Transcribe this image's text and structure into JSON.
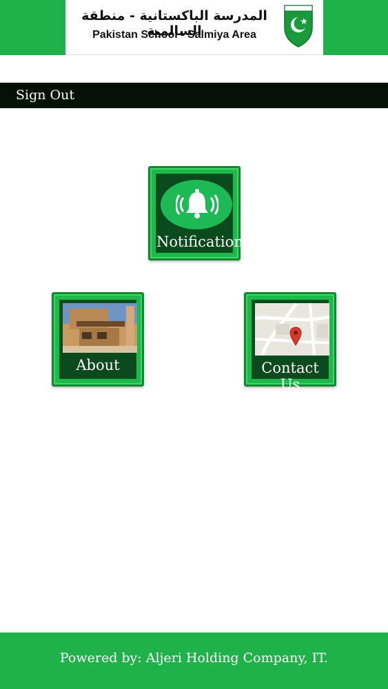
{
  "header": {
    "arabic_name": "المدرسة الباكستانية - منطقة السالمية",
    "english_name": "Pakistan School - Salmiya Area",
    "brand_color": "#20b24a"
  },
  "nav": {
    "sign_out_label": "Sign Out"
  },
  "tiles": {
    "notifications": {
      "label": "Notifications",
      "icon": "bell-icon"
    },
    "about": {
      "label": "About",
      "icon": "school-building-photo"
    },
    "contact": {
      "label": "Contact Us",
      "icon": "map-pin-icon"
    }
  },
  "footer": {
    "powered_by": "Powered by: Aljeri Holding Company, IT."
  }
}
